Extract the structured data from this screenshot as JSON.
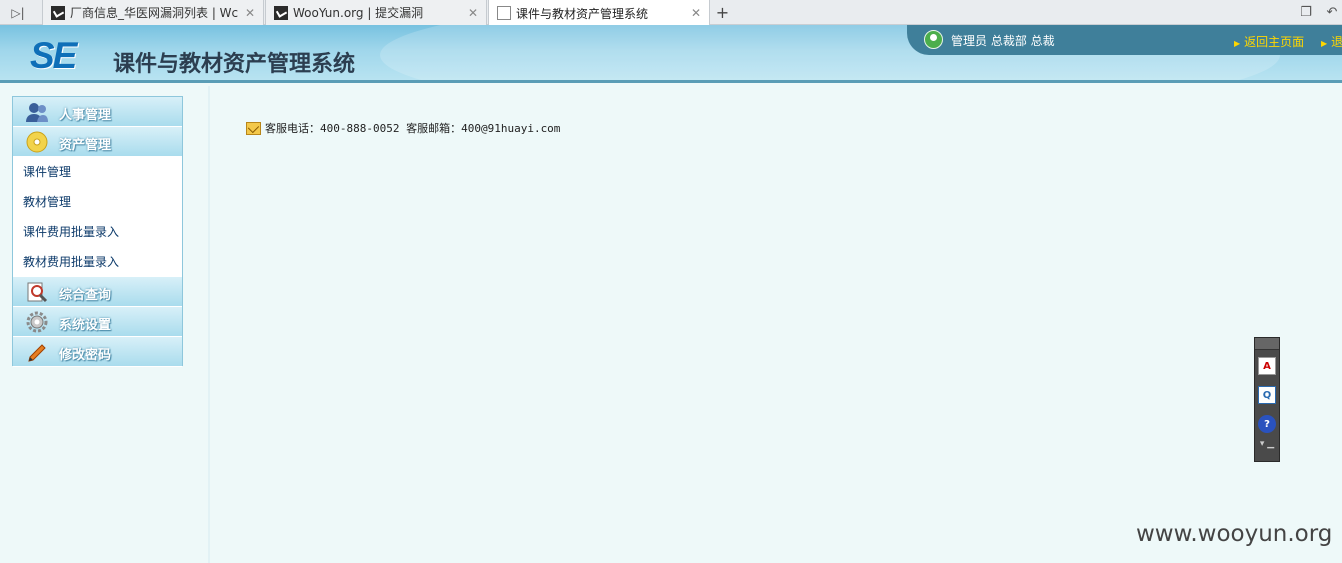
{
  "browser": {
    "nav_icon": "sidebar-toggle-icon",
    "tabs": [
      {
        "title": "厂商信息_华医网漏洞列表 | Wc",
        "close": "✕",
        "favicon": "wooyun-favicon"
      },
      {
        "title": "WooYun.org | 提交漏洞",
        "close": "✕",
        "favicon": "wooyun-favicon"
      },
      {
        "title": "课件与教材资产管理系统",
        "close": "✕",
        "favicon": "document-favicon"
      }
    ],
    "new_tab": "+",
    "right_icons": [
      "restore-window-icon",
      "undo-icon"
    ]
  },
  "header": {
    "logo": "SE",
    "title": "课件与教材资产管理系统",
    "user_text": "管理员 总裁部 总裁",
    "links": [
      "返回主页面",
      "退"
    ]
  },
  "sidebar": {
    "menus": [
      {
        "label": "人事管理",
        "icon": "users-icon"
      },
      {
        "label": "资产管理",
        "icon": "disc-icon"
      },
      {
        "label": "综合查询",
        "icon": "search-doc-icon"
      },
      {
        "label": "系统设置",
        "icon": "gear-icon"
      },
      {
        "label": "修改密码",
        "icon": "pen-icon"
      }
    ],
    "asset_items": [
      "课件管理",
      "教材管理",
      "课件费用批量录入",
      "教材费用批量录入"
    ]
  },
  "main": {
    "contact": "客服电话：400-888-0052 客服邮箱：400@91huayi.com"
  },
  "floatbar": {
    "buttons": [
      {
        "icon": "pdf-icon",
        "glyph": "A"
      },
      {
        "icon": "quote-icon",
        "glyph": "Q"
      },
      {
        "icon": "help-icon",
        "glyph": "?"
      }
    ],
    "more": "▾ ▁"
  },
  "watermark": "www.wooyun.org",
  "colors": {
    "accent": "#3f7f9a",
    "header": "#9fd6eb",
    "link": "#ffd700",
    "menu_text": "#0c3a6a"
  }
}
